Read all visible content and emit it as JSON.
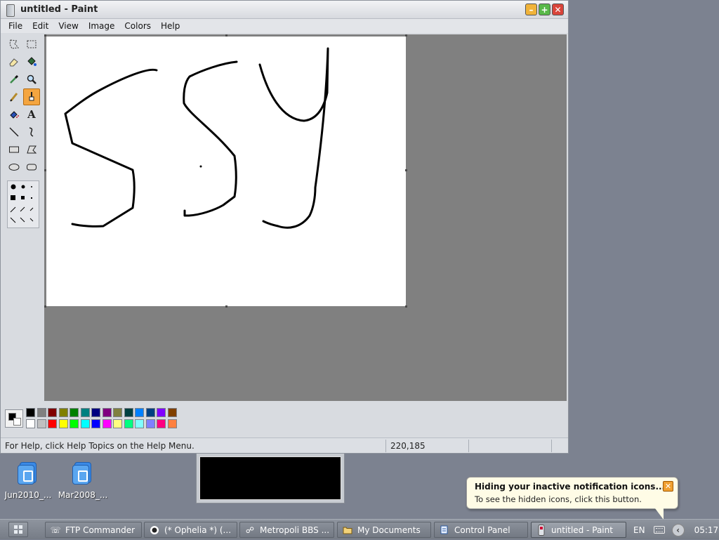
{
  "window": {
    "title": "untitled - Paint",
    "buttons": {
      "minimize": "–",
      "maximize": "+",
      "close": "✕"
    }
  },
  "menu": [
    "File",
    "Edit",
    "View",
    "Image",
    "Colors",
    "Help"
  ],
  "tools": [
    {
      "name": "free-form-select",
      "icon": "free-select-icon"
    },
    {
      "name": "select",
      "icon": "rect-select-icon"
    },
    {
      "name": "eraser",
      "icon": "eraser-icon"
    },
    {
      "name": "fill-with-color",
      "icon": "paint-bucket-icon"
    },
    {
      "name": "pick-color",
      "icon": "eyedropper-icon"
    },
    {
      "name": "magnifier",
      "icon": "magnifier-icon"
    },
    {
      "name": "pencil",
      "icon": "pencil-icon"
    },
    {
      "name": "brush",
      "icon": "brush-icon",
      "active": true
    },
    {
      "name": "airbrush",
      "icon": "airbrush-icon"
    },
    {
      "name": "text",
      "icon": "text-icon",
      "glyph": "A"
    },
    {
      "name": "line",
      "icon": "line-icon"
    },
    {
      "name": "curve",
      "icon": "curve-icon"
    },
    {
      "name": "rectangle",
      "icon": "rectangle-icon"
    },
    {
      "name": "polygon",
      "icon": "polygon-icon"
    },
    {
      "name": "ellipse",
      "icon": "ellipse-icon"
    },
    {
      "name": "rounded-rectangle",
      "icon": "rounded-rect-icon"
    }
  ],
  "palette": {
    "foreground": "#000000",
    "background": "#ffffff",
    "row1": [
      "#000000",
      "#808080",
      "#800000",
      "#808000",
      "#008000",
      "#008080",
      "#000080",
      "#800080",
      "#808040",
      "#004040",
      "#0080ff",
      "#004080",
      "#8000ff",
      "#804000"
    ],
    "row2": [
      "#ffffff",
      "#c0c0c0",
      "#ff0000",
      "#ffff00",
      "#00ff00",
      "#00ffff",
      "#0000ff",
      "#ff00ff",
      "#ffff80",
      "#00ff80",
      "#80ffff",
      "#8080ff",
      "#ff0080",
      "#ff8040"
    ]
  },
  "status": {
    "help": "For Help, click Help Topics on the Help Menu.",
    "coords": "220,185"
  },
  "desktop": {
    "icons": [
      {
        "label": "Jun2010_..."
      },
      {
        "label": "Mar2008_..."
      }
    ]
  },
  "balloon": {
    "title": "Hiding your inactive notification icons...",
    "text": "To see the hidden icons, click this button."
  },
  "taskbar": {
    "tasks": [
      {
        "label": "FTP Commander",
        "icon": "ftp-icon"
      },
      {
        "label": "(* Ophelia *) (...",
        "icon": "media-player-icon"
      },
      {
        "label": "Metropoli BBS ...",
        "icon": "bbs-icon"
      },
      {
        "label": "My Documents",
        "icon": "folder-icon"
      },
      {
        "label": "Control Panel",
        "icon": "control-panel-icon"
      },
      {
        "label": "untitled - Paint",
        "icon": "paint-icon",
        "active": true
      }
    ],
    "tray": {
      "language": "EN",
      "clock": "05:17"
    }
  }
}
